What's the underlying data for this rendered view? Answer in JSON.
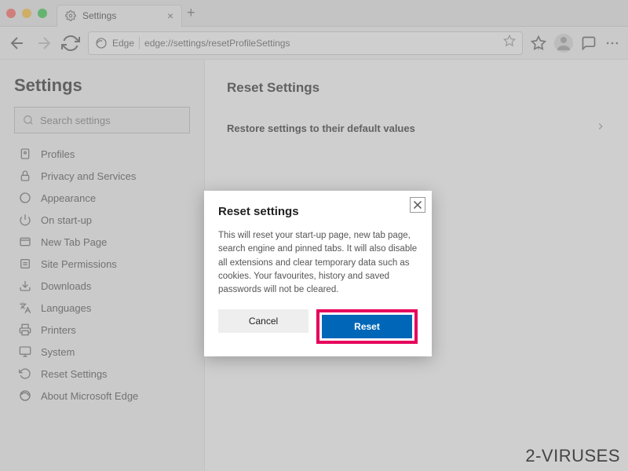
{
  "window": {
    "tab_title": "Settings",
    "new_tab_plus": "+"
  },
  "toolbar": {
    "address_prefix": "Edge",
    "url": "edge://settings/resetProfileSettings"
  },
  "sidebar": {
    "title": "Settings",
    "search_placeholder": "Search settings",
    "items": [
      {
        "label": "Profiles"
      },
      {
        "label": "Privacy and Services"
      },
      {
        "label": "Appearance"
      },
      {
        "label": "On start-up"
      },
      {
        "label": "New Tab Page"
      },
      {
        "label": "Site Permissions"
      },
      {
        "label": "Downloads"
      },
      {
        "label": "Languages"
      },
      {
        "label": "Printers"
      },
      {
        "label": "System"
      },
      {
        "label": "Reset Settings"
      },
      {
        "label": "About Microsoft Edge"
      }
    ]
  },
  "content": {
    "section_title": "Reset Settings",
    "row_label": "Restore settings to their default values"
  },
  "dialog": {
    "title": "Reset settings",
    "body": "This will reset your start-up page, new tab page, search engine and pinned tabs. It will also disable all extensions and clear temporary data such as cookies. Your favourites, history and saved passwords will not be cleared.",
    "cancel": "Cancel",
    "reset": "Reset"
  },
  "watermark": "2-VIRUSES"
}
